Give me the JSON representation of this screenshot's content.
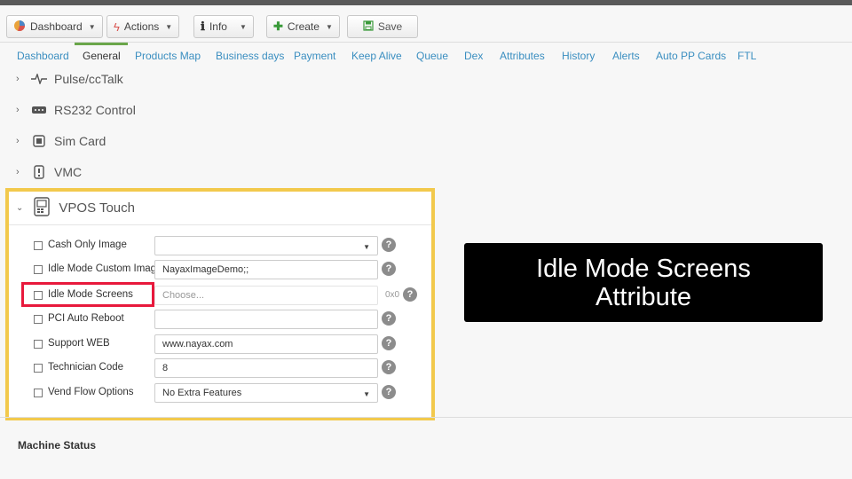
{
  "toolbar": {
    "dashboard": "Dashboard",
    "actions": "Actions",
    "info": "Info",
    "create": "Create",
    "save": "Save"
  },
  "tabs": [
    "Dashboard",
    "General",
    "Products Map",
    "Business days",
    "Payment",
    "Keep Alive",
    "Queue",
    "Dex",
    "Attributes",
    "History",
    "Alerts",
    "Auto PP Cards",
    "FTL"
  ],
  "active_tab": "General",
  "sections": {
    "pulse": "Pulse/ccTalk",
    "rs232": "RS232 Control",
    "sim": "Sim Card",
    "vmc": "VMC",
    "vpos": "VPOS Touch"
  },
  "fields": {
    "cash_only_image": {
      "label": "Cash Only Image",
      "value": ""
    },
    "idle_mode_custom_image": {
      "label": "Idle Mode Custom Image",
      "value": "NayaxImageDemo;;"
    },
    "idle_mode_screens": {
      "label": "Idle Mode Screens",
      "placeholder": "Choose...",
      "count": "0x0"
    },
    "pci_auto_reboot": {
      "label": "PCI Auto Reboot",
      "value": ""
    },
    "support_web": {
      "label": "Support WEB",
      "value": "www.nayax.com"
    },
    "technician_code": {
      "label": "Technician Code",
      "value": "8"
    },
    "vend_flow_options": {
      "label": "Vend Flow Options",
      "value": "No Extra Features"
    }
  },
  "help_glyph": "?",
  "machine_status": "Machine Status",
  "callout": {
    "line1": "Idle Mode Screens",
    "line2": "Attribute"
  },
  "colors": {
    "link": "#3a8ec0",
    "highlight": "#f2c94c",
    "marker": "#e8193c",
    "accent_green": "#6aa64a"
  }
}
